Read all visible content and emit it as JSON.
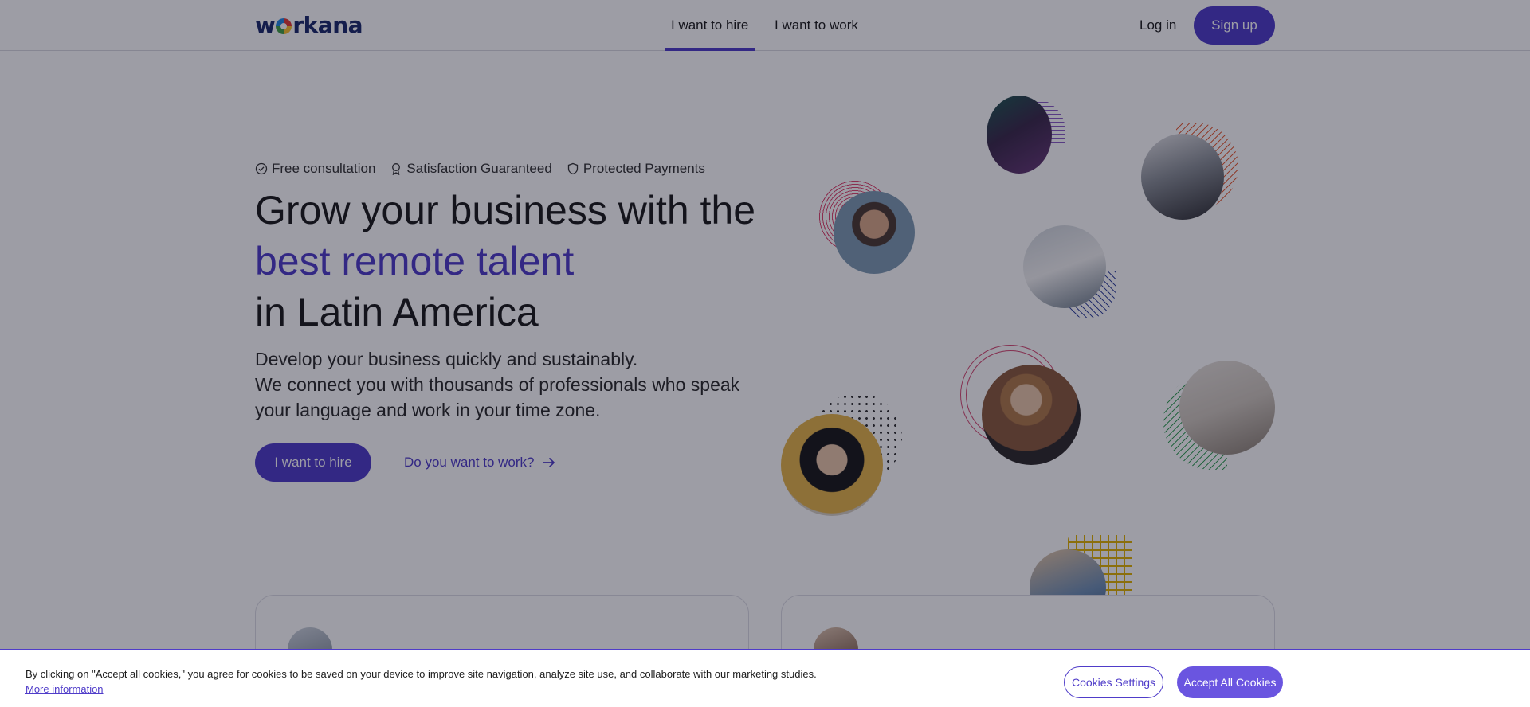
{
  "header": {
    "logo_text_left": "w",
    "logo_text_right": "rkana",
    "tabs": [
      {
        "label": "I want to hire",
        "active": true
      },
      {
        "label": "I want to work",
        "active": false
      }
    ],
    "login_label": "Log in",
    "signup_label": "Sign up"
  },
  "hero": {
    "badges": [
      {
        "icon": "check-circle-icon",
        "label": "Free consultation"
      },
      {
        "icon": "award-icon",
        "label": "Satisfaction Guaranteed"
      },
      {
        "icon": "shield-icon",
        "label": "Protected Payments"
      }
    ],
    "headline_line1": "Grow your business with the",
    "headline_accent": "best remote talent",
    "headline_line3": "in Latin America",
    "sub_line1": "Develop your business quickly and sustainably.",
    "sub_line2": "We connect you with thousands of professionals who speak your language and work in your time zone.",
    "cta_hire": "I want to hire",
    "cta_work": "Do you want to work?"
  },
  "cookie": {
    "text": "By clicking on \"Accept all cookies,\" you agree for cookies to be saved on your device to improve site navigation, analyze site use, and collaborate with our marketing studies.",
    "more_info": "More information",
    "settings_label": "Cookies Settings",
    "accept_label": "Accept All Cookies"
  },
  "colors": {
    "accent": "#4f3cc9",
    "logo": "#1c2a6b"
  }
}
